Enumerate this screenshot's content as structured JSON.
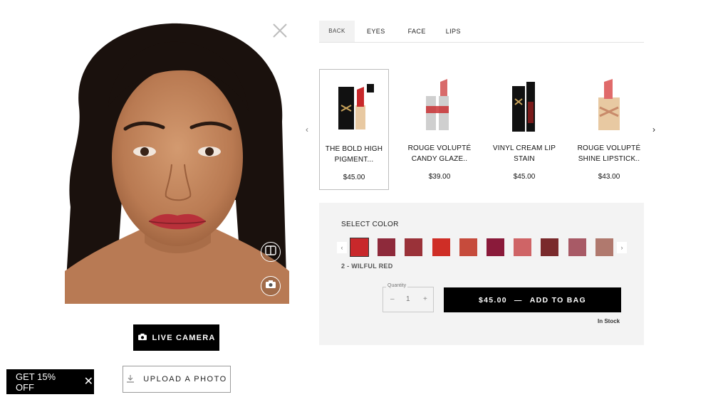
{
  "tabs": {
    "back": "BACK",
    "eyes": "EYES",
    "face": "FACE",
    "lips": "LIPS"
  },
  "products": [
    {
      "name": "THE BOLD HIGH PIGMENT...",
      "price": "$45.00",
      "selected": true,
      "icon": "lipstick-black-case"
    },
    {
      "name": "ROUGE VOLUPTÉ CANDY GLAZE..",
      "price": "$39.00",
      "selected": false,
      "icon": "lipstick-silver-case"
    },
    {
      "name": "VINYL CREAM LIP STAIN",
      "price": "$45.00",
      "selected": false,
      "icon": "lip-stain-bottle"
    },
    {
      "name": "ROUGE VOLUPTÉ SHINE LIPSTICK..",
      "price": "$43.00",
      "selected": false,
      "icon": "lipstick-gold-case"
    }
  ],
  "color": {
    "label": "SELECT COLOR",
    "selected_name": "2 - WILFUL RED",
    "swatches": [
      "#c8282b",
      "#8e2a3b",
      "#9a3239",
      "#cf2e26",
      "#c64b3c",
      "#8a1a3a",
      "#cf6466",
      "#7a2a2c",
      "#a85a66",
      "#b0796e"
    ]
  },
  "quantity": {
    "label": "Quantity",
    "minus": "–",
    "value": "1",
    "plus": "+"
  },
  "cart": {
    "price": "$45.00",
    "dash": "—",
    "label": "ADD TO BAG",
    "stock": "In Stock"
  },
  "buttons": {
    "live_camera": "LIVE CAMERA",
    "upload_photo": "UPLOAD A PHOTO"
  },
  "promo": {
    "label": "GET 15% OFF",
    "close": "✕"
  },
  "colors": {
    "lip": "#b8303a",
    "skin": "#c68a62",
    "hair": "#1a110d"
  }
}
